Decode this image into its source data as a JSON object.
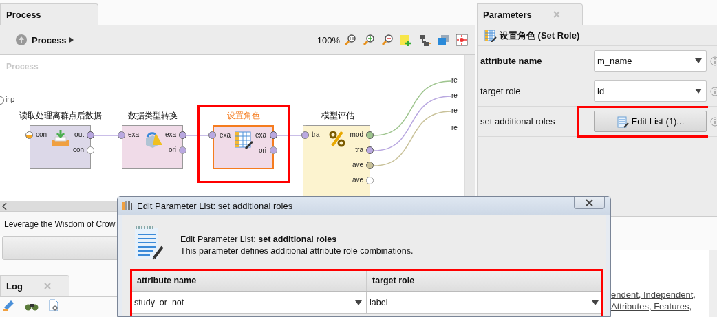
{
  "process_tab": {
    "label": "Process"
  },
  "process_toolbar": {
    "breadcrumb": "Process",
    "zoom": "100%"
  },
  "canvas": {
    "title": "Process",
    "input_port": "inp",
    "operators": [
      {
        "label": "读取处理离群点后数据",
        "kind": "read",
        "selected": false,
        "inputs": [
          {
            "label": "con",
            "color": "#f5a623"
          }
        ],
        "outputs": [
          {
            "label": "out",
            "color": "#b9a8e0",
            "connected": true
          },
          {
            "label": "con",
            "color": "#ffffff",
            "connected": false
          }
        ]
      },
      {
        "label": "数据类型转换",
        "kind": "convert",
        "selected": false,
        "inputs": [
          {
            "label": "exa",
            "color": "#b9a8e0"
          }
        ],
        "outputs": [
          {
            "label": "exa",
            "color": "#b9a8e0",
            "connected": true
          },
          {
            "label": "ori",
            "color": "#b9a8e0",
            "connected": false
          }
        ]
      },
      {
        "label": "设置角色",
        "kind": "role",
        "selected": true,
        "highlighted": true,
        "inputs": [
          {
            "label": "exa",
            "color": "#b9a8e0"
          }
        ],
        "outputs": [
          {
            "label": "exa",
            "color": "#b9a8e0",
            "connected": true
          },
          {
            "label": "ori",
            "color": "#b9a8e0",
            "connected": false
          }
        ]
      },
      {
        "label": "模型评估",
        "kind": "evaluate",
        "selected": false,
        "inputs": [
          {
            "label": "tra",
            "color": "#b9a8e0"
          }
        ],
        "outputs": [
          {
            "label": "mod",
            "color": "#9fc58f",
            "connected": true
          },
          {
            "label": "tra",
            "color": "#b9a8e0",
            "connected": true
          },
          {
            "label": "ave",
            "color": "#c9c29a",
            "connected": true
          },
          {
            "label": "ave",
            "color": "#ffffff",
            "connected": false
          }
        ]
      }
    ],
    "result_ports": [
      "re",
      "re",
      "re",
      "re"
    ]
  },
  "help_text": "Leverage the Wisdom of Crow",
  "log_tab": {
    "label": "Log"
  },
  "parameters": {
    "tab": "Parameters",
    "operator_title": "设置角色 (Set Role)",
    "rows": [
      {
        "label": "attribute name",
        "kind": "dropdown",
        "value": "m_name",
        "required": true,
        "highlighted": false
      },
      {
        "label": "target role",
        "kind": "dropdown",
        "value": "id",
        "required": false,
        "highlighted": false
      },
      {
        "label": "set additional roles",
        "kind": "button",
        "value": "Edit List (1)...",
        "required": false,
        "highlighted": true
      }
    ]
  },
  "help_links": [
    "endent, Independent,",
    "Attributes, Features,"
  ],
  "dialog": {
    "title": "Edit Parameter List: set additional roles",
    "heading": "Edit Parameter List: **set additional roles**",
    "description": "This parameter defines additional attribute role combinations.",
    "highlighted": true,
    "columns": [
      "attribute name",
      "target role"
    ],
    "rows": [
      [
        "study_or_not",
        "label"
      ]
    ]
  }
}
